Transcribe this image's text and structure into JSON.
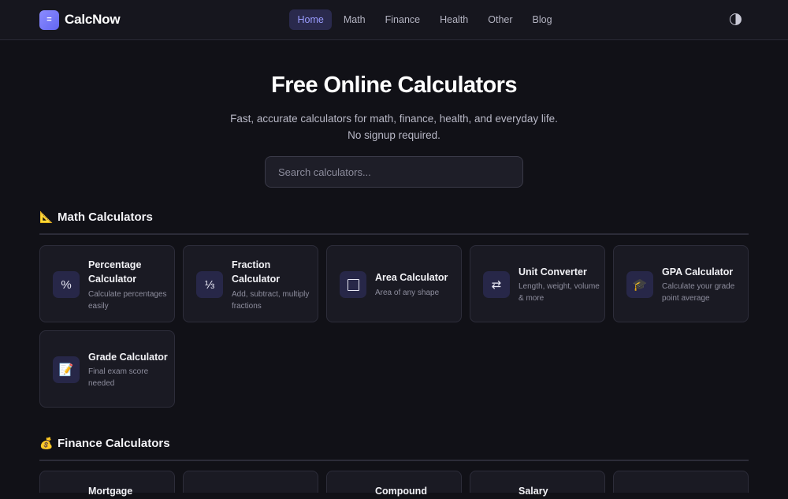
{
  "header": {
    "logo_mark": "=",
    "logo_text": "CalcNow",
    "nav": [
      {
        "label": "Home",
        "active": true
      },
      {
        "label": "Math",
        "active": false
      },
      {
        "label": "Finance",
        "active": false
      },
      {
        "label": "Health",
        "active": false
      },
      {
        "label": "Other",
        "active": false
      },
      {
        "label": "Blog",
        "active": false
      }
    ],
    "theme_toggle_icon": "half-circle-icon"
  },
  "hero": {
    "title": "Free Online Calculators",
    "subtitle": "Fast, accurate calculators for math, finance, health, and everyday life. No signup required.",
    "search_placeholder": "Search calculators..."
  },
  "math_section": {
    "icon": "📐",
    "title": "Math Calculators",
    "cards": [
      {
        "icon": "%",
        "title": "Percentage Calculator",
        "desc": "Calculate percentages easily"
      },
      {
        "icon": "⅓",
        "title": "Fraction Calculator",
        "desc": "Add, subtract, multiply fractions"
      },
      {
        "icon": "square-icon",
        "title": "Area Calculator",
        "desc": "Area of any shape"
      },
      {
        "icon": "⇄",
        "title": "Unit Converter",
        "desc": "Length, weight, volume & more"
      },
      {
        "icon": "🎓",
        "title": "GPA Calculator",
        "desc": "Calculate your grade point average"
      },
      {
        "icon": "📝",
        "title": "Grade Calculator",
        "desc": "Final exam score needed"
      }
    ]
  },
  "finance_section": {
    "icon": "💰",
    "title": "Finance Calculators",
    "cards": [
      {
        "title": "Mortgage"
      },
      {
        "title": ""
      },
      {
        "title": "Compound"
      },
      {
        "title": "Salary"
      },
      {
        "title": ""
      }
    ]
  },
  "colors": {
    "background": "#111117",
    "accent": "#6366f1",
    "nav_active_text": "#9a9cff"
  }
}
